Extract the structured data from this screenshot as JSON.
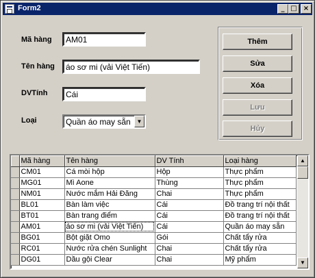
{
  "window": {
    "title": "Form2"
  },
  "form": {
    "ma_hang": {
      "label": "Mã hàng",
      "value": "AM01"
    },
    "ten_hang": {
      "label": "Tên hàng",
      "value": "áo sơ mi (vải Việt Tiến)"
    },
    "dvt": {
      "label": "DVTính",
      "value": "Cái"
    },
    "loai": {
      "label": "Loại",
      "value": "Quần áo may sẵn"
    }
  },
  "buttons": {
    "them": "Thêm",
    "sua": "Sửa",
    "xoa": "Xóa",
    "luu": "Lưu",
    "huy": "Hủy"
  },
  "grid": {
    "columns": [
      "Mã hàng",
      "Tên hàng",
      "DV Tính",
      "Loại hàng"
    ],
    "rows": [
      [
        "CM01",
        "Cá mòi hộp",
        "Hộp",
        "Thực phẩm"
      ],
      [
        "MG01",
        "Mì Aone",
        "Thùng",
        "Thực phẩm"
      ],
      [
        "NM01",
        "Nước mắm Hải Đăng",
        "Chai",
        "Thực phẩm"
      ],
      [
        "BL01",
        "Bàn làm việc",
        "Cái",
        "Đồ trang trí nội thất"
      ],
      [
        "BT01",
        "Bàn trang điểm",
        "Cái",
        "Đồ trang trí nội thất"
      ],
      [
        "AM01",
        "áo sơ mi (vải Việt Tiến)",
        "Cái",
        "Quần áo may sẵn"
      ],
      [
        "BG01",
        "Bột giặt Omo",
        "Gói",
        "Chất tẩy rửa"
      ],
      [
        "RC01",
        "Nước rửa chén Sunlight",
        "Chai",
        "Chất tẩy rửa"
      ],
      [
        "DG01",
        "Dầu gội Clear",
        "Chai",
        "Mỹ phẩm"
      ]
    ],
    "selected_row": 5
  }
}
